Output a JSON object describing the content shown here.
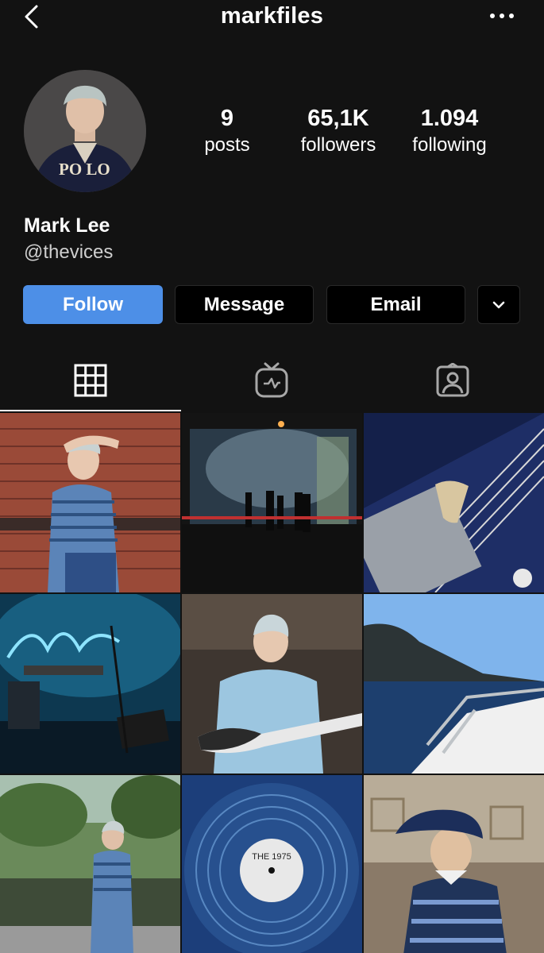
{
  "header": {
    "username": "markfiles"
  },
  "profile": {
    "avatar_text": "PO LO",
    "name": "Mark Lee",
    "handle": "@thevices"
  },
  "stats": [
    {
      "value": "9",
      "label": "posts"
    },
    {
      "value": "65,1K",
      "label": "followers"
    },
    {
      "value": "1.094",
      "label": "following"
    }
  ],
  "actions": {
    "follow": "Follow",
    "message": "Message",
    "email": "Email"
  },
  "tabs": [
    {
      "icon": "grid-icon",
      "active": true
    },
    {
      "icon": "igtv-icon",
      "active": false
    },
    {
      "icon": "tagged-icon",
      "active": false
    }
  ],
  "posts": [
    {
      "subject": "brick-wall-portrait"
    },
    {
      "subject": "stage-silhouettes"
    },
    {
      "subject": "guitar-closeup"
    },
    {
      "subject": "concert-stage"
    },
    {
      "subject": "bass-player"
    },
    {
      "subject": "boat-sea"
    },
    {
      "subject": "outdoor-portrait"
    },
    {
      "subject": "vinyl-record",
      "overlay_text": "THE 1975"
    },
    {
      "subject": "cap-portrait"
    }
  ],
  "colors": {
    "background": "#121212",
    "follow_button": "#4d8fe7",
    "secondary_button": "#000000"
  }
}
